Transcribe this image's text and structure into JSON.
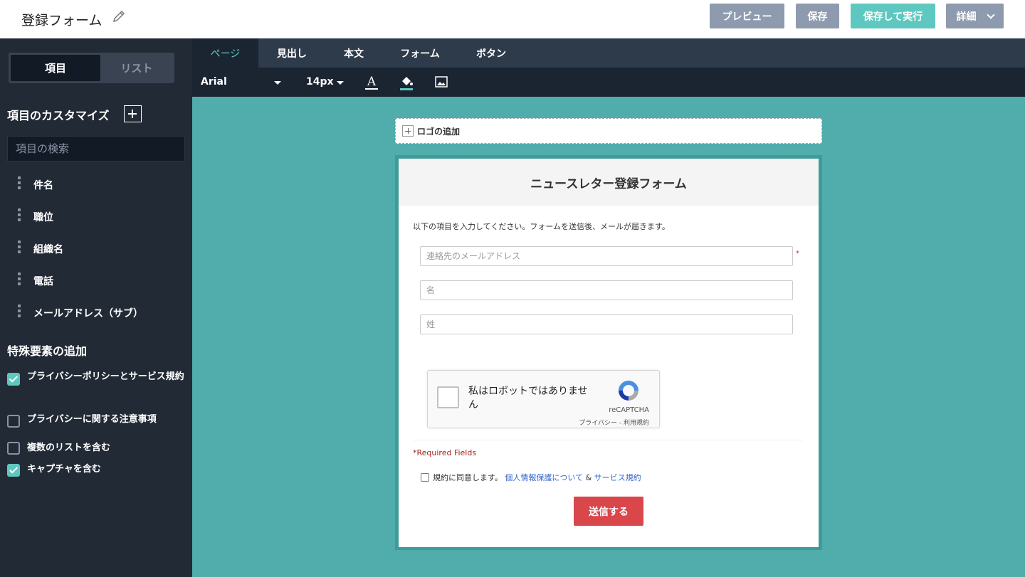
{
  "header": {
    "title": "登録フォーム",
    "buttons": {
      "preview": "プレビュー",
      "save": "保存",
      "save_run": "保存して実行",
      "details": "詳細"
    }
  },
  "sidebar": {
    "segments": {
      "items": "項目",
      "list": "リスト"
    },
    "customize_title": "項目のカスタマイズ",
    "search_placeholder": "項目の検索",
    "fields": [
      "件名",
      "職位",
      "組織名",
      "電話",
      "メールアドレス（サブ）"
    ],
    "special_title": "特殊要素の追加",
    "options": [
      {
        "label": "プライバシーポリシーとサービス規約",
        "checked": true
      },
      {
        "label": "プライバシーに関する注意事項",
        "checked": false
      },
      {
        "label": "複数のリストを含む",
        "checked": false
      },
      {
        "label": "キャプチャを含む",
        "checked": true
      }
    ]
  },
  "editor": {
    "tabs": [
      "ページ",
      "見出し",
      "本文",
      "フォーム",
      "ボタン"
    ],
    "active_tab": "ページ",
    "toolbar": {
      "font": "Arial",
      "size": "14px"
    }
  },
  "canvas": {
    "background": "#51adac",
    "logo_add": "ロゴの追加",
    "form": {
      "heading": "ニュースレター登録フォーム",
      "description": "以下の項目を入力してください。フォームを送信後、メールが届きます。",
      "fields": {
        "email_placeholder": "連絡先のメールアドレス",
        "first_name_placeholder": "名",
        "last_name_placeholder": "姓"
      },
      "required_mark": "*",
      "captcha": {
        "text": "私はロボットではありません",
        "brand": "reCAPTCHA",
        "links": "プライバシー - 利用規約"
      },
      "required_fields": "*Required Fields",
      "agree": {
        "prefix": "規約に同意します。",
        "privacy_link": "個人情報保護について",
        "amp": "&",
        "terms_link": "サービス規約"
      },
      "submit": "送信する"
    }
  },
  "colors": {
    "accent": "#5ec8c0",
    "sidebar_bg": "#222a36",
    "submit": "#d9474b",
    "gray_button": "#8e9aae"
  }
}
